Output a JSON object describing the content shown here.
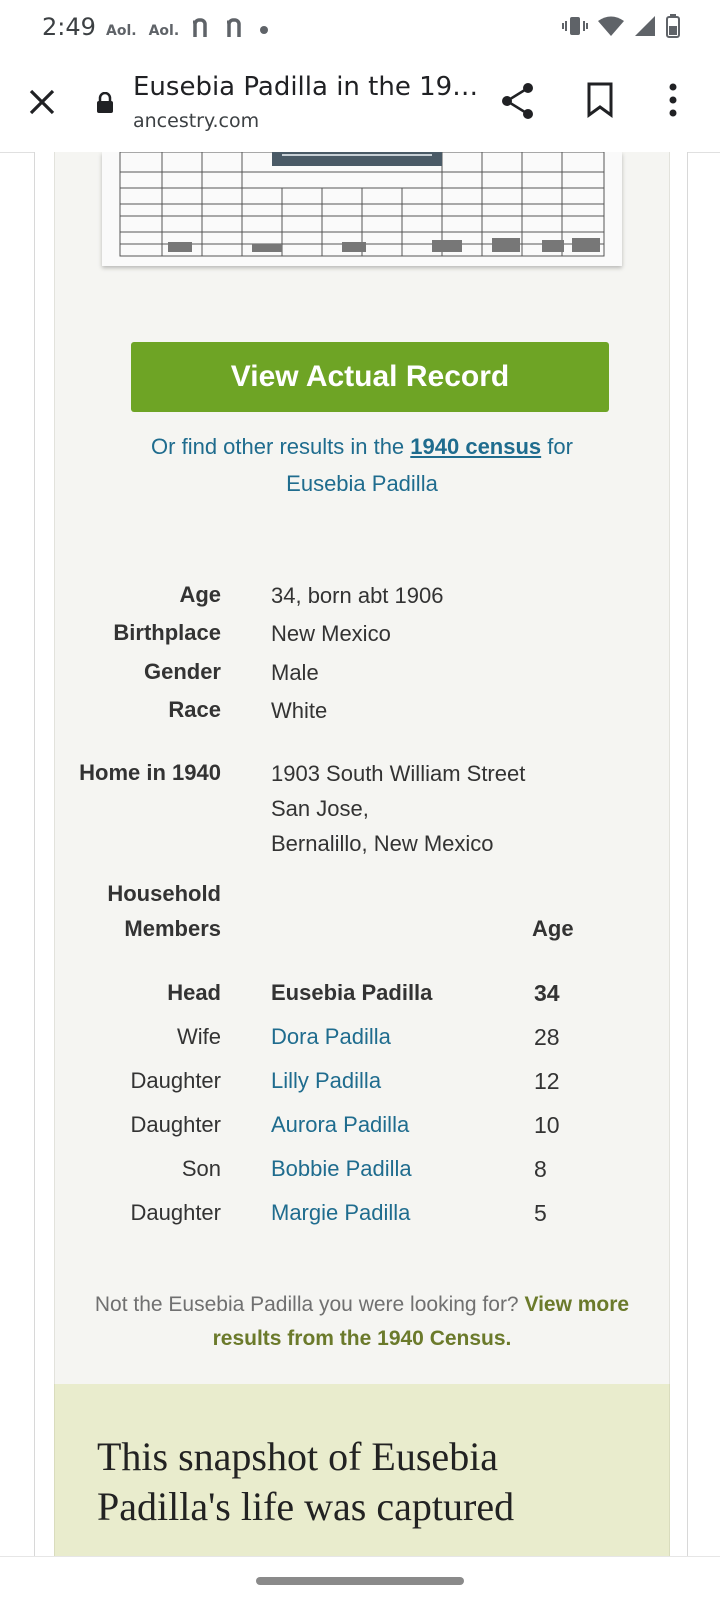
{
  "status": {
    "time": "2:49",
    "notifications": [
      "Aol.",
      "Aol."
    ],
    "extra_icons": [
      "n-icon",
      "n-icon",
      "dot"
    ]
  },
  "browser": {
    "title": "Eusebia Padilla in the 19…",
    "url": "ancestry.com"
  },
  "record": {
    "view_button": "View Actual Record",
    "find_prefix": "Or find other results in the ",
    "find_link": "1940 census",
    "find_suffix": " for",
    "find_name": "Eusebia Padilla"
  },
  "facts": [
    {
      "label": "Age",
      "value": "34, born abt 1906"
    },
    {
      "label": "Birthplace",
      "value": "New Mexico"
    },
    {
      "label": "Gender",
      "value": "Male"
    },
    {
      "label": "Race",
      "value": "White"
    }
  ],
  "home": {
    "label": "Home in 1940",
    "line1": "1903 South William Street",
    "line2": "San Jose,",
    "line3": "Bernalillo, New Mexico"
  },
  "household": {
    "label_line1": "Household",
    "label_line2": "Members",
    "age_header": "Age",
    "members": [
      {
        "relation": "Head",
        "name": "Eusebia Padilla",
        "age": "34"
      },
      {
        "relation": "Wife",
        "name": "Dora Padilla",
        "age": "28"
      },
      {
        "relation": "Daughter",
        "name": "Lilly Padilla",
        "age": "12"
      },
      {
        "relation": "Daughter",
        "name": "Aurora Padilla",
        "age": "10"
      },
      {
        "relation": "Son",
        "name": "Bobbie Padilla",
        "age": "8"
      },
      {
        "relation": "Daughter",
        "name": "Margie Padilla",
        "age": "5"
      }
    ]
  },
  "not_found": {
    "prefix": "Not the Eusebia Padilla you were looking for? ",
    "link_line1": "View more",
    "link_line2": "results from the 1940 Census."
  },
  "snapshot": {
    "text": "This snapshot of Eusebia Padilla's life was captured"
  },
  "colors": {
    "button_green": "#6ea425",
    "link_blue": "#1f6c8e",
    "olive_link": "#6b7a2b",
    "snapshot_bg": "#e9eccd"
  }
}
